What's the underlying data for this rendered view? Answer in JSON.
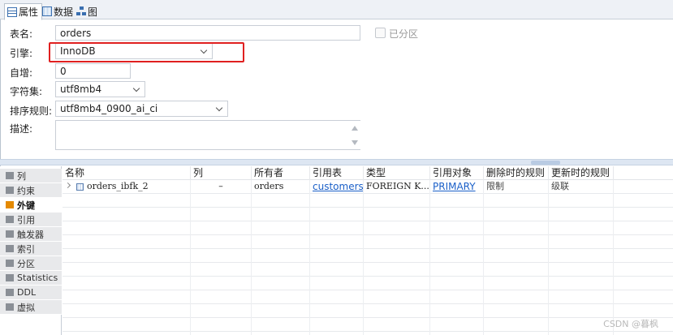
{
  "tabs": [
    {
      "label": "属性",
      "icon": "properties-icon",
      "active": true
    },
    {
      "label": "数据",
      "icon": "data-grid-icon",
      "active": false
    },
    {
      "label": "图",
      "icon": "er-diagram-icon",
      "active": false
    }
  ],
  "form": {
    "table_name_label": "表名:",
    "table_name_value": "orders",
    "partitioned_label": "已分区",
    "engine_label": "引擎:",
    "engine_value": "InnoDB",
    "auto_inc_label": "自增:",
    "auto_inc_value": "0",
    "charset_label": "字符集:",
    "charset_value": "utf8mb4",
    "collation_label": "排序规则:",
    "collation_value": "utf8mb4_0900_ai_ci",
    "description_label": "描述:",
    "description_value": ""
  },
  "highlight_color": "#e02020",
  "sidebar": {
    "items": [
      {
        "label": "列",
        "icon": "columns-icon",
        "active": false
      },
      {
        "label": "约束",
        "icon": "constraint-icon",
        "active": false
      },
      {
        "label": "外键",
        "icon": "foreign-key-icon",
        "active": true
      },
      {
        "label": "引用",
        "icon": "reference-icon",
        "active": false
      },
      {
        "label": "触发器",
        "icon": "trigger-icon",
        "active": false
      },
      {
        "label": "索引",
        "icon": "index-icon",
        "active": false
      },
      {
        "label": "分区",
        "icon": "partition-icon",
        "active": false
      },
      {
        "label": "Statistics",
        "icon": "statistics-icon",
        "active": false
      },
      {
        "label": "DDL",
        "icon": "ddl-icon",
        "active": false
      },
      {
        "label": "虚拟",
        "icon": "virtual-icon",
        "active": false
      }
    ]
  },
  "grid": {
    "columns": [
      "名称",
      "列",
      "所有者",
      "引用表",
      "类型",
      "引用对象",
      "删除时的规则",
      "更新时的规则"
    ],
    "rows": [
      {
        "name": "orders_ibfk_2",
        "column": "–",
        "owner": "orders",
        "ref_table": "customers",
        "type": "FOREIGN K...",
        "ref_object": "PRIMARY",
        "on_delete": "限制",
        "on_update": "级联"
      }
    ]
  },
  "watermark": "CSDN @暮枫"
}
